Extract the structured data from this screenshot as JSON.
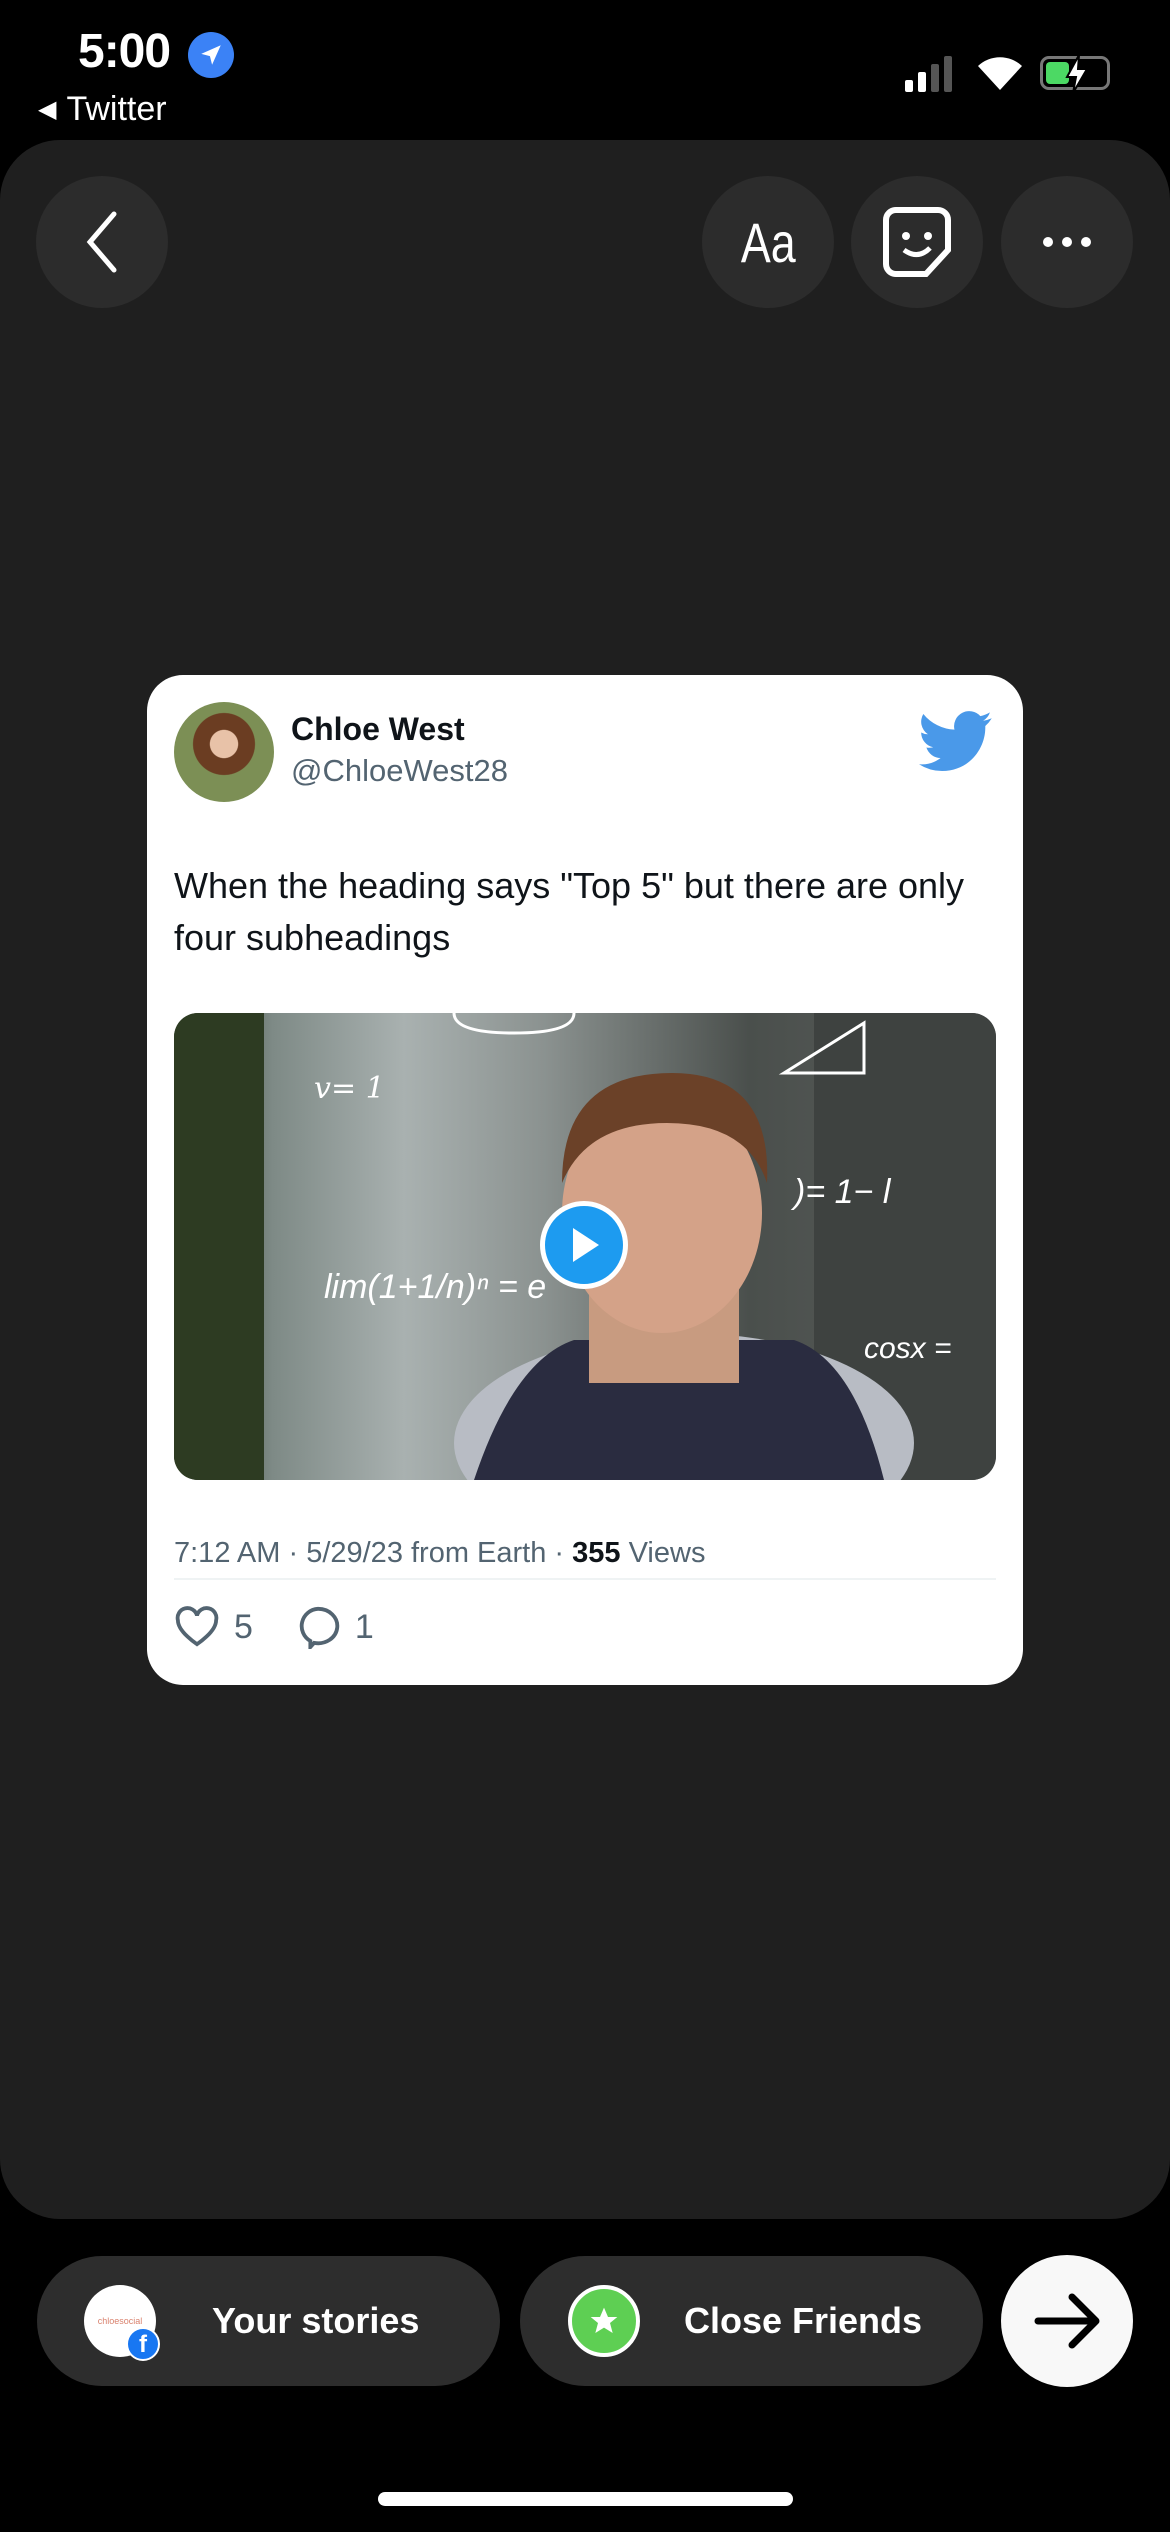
{
  "status_bar": {
    "time": "5:00",
    "back_app": "Twitter",
    "battery_charging": true
  },
  "toolbar": {
    "back": "back-icon",
    "text": "Aa",
    "sticker": "sticker-icon",
    "more": "more-icon"
  },
  "tweet": {
    "name": "Chloe West",
    "handle": "@ChloeWest28",
    "text": "When the heading says \"Top 5\" but there are only four subheadings",
    "media_overlay": [
      "v= 1",
      ")= 1− l",
      "lim(1+1/n)ⁿ = e",
      "cosx ="
    ],
    "time": "7:12 AM",
    "date": "5/29/23 from Earth",
    "views_count": "355",
    "views_label": "Views",
    "likes": "5",
    "replies": "1",
    "brand_color": "#1d9bf0"
  },
  "share": {
    "your_stories": "Your stories",
    "avatar_text": "chloesocial",
    "close_friends": "Close Friends",
    "close_friends_color": "#5ecf53"
  }
}
